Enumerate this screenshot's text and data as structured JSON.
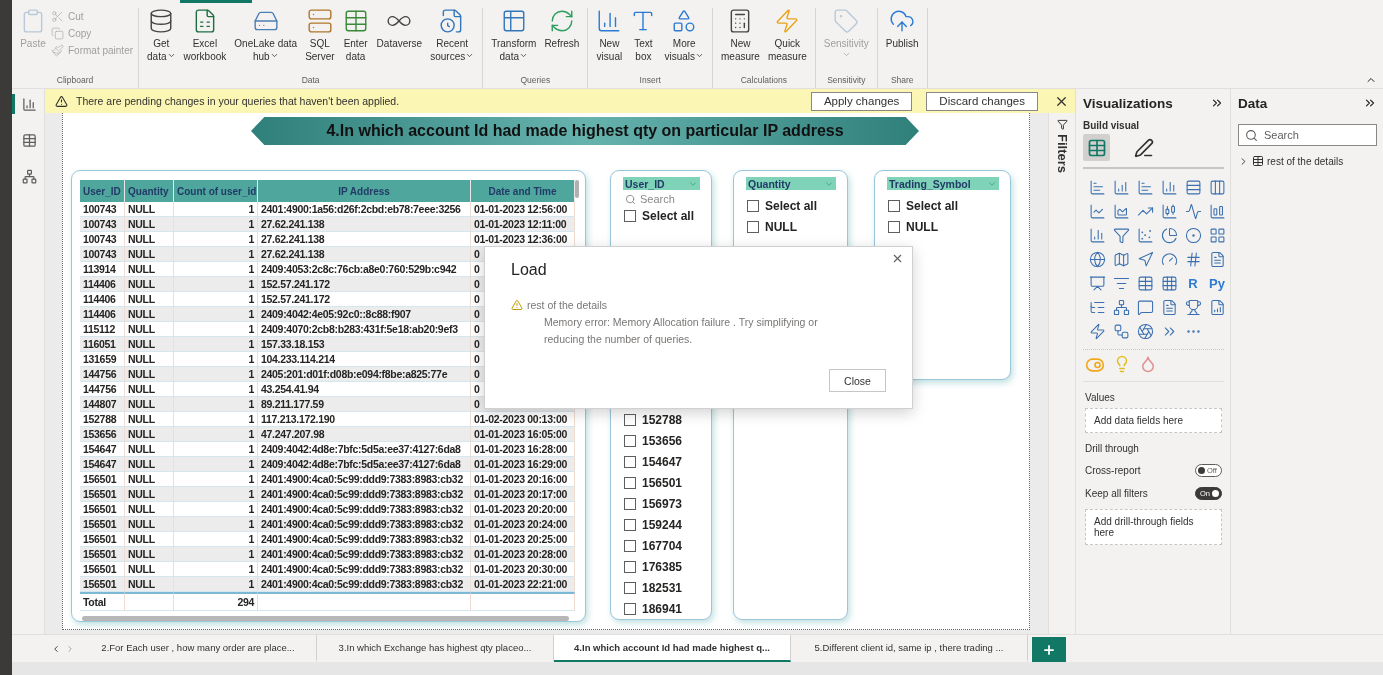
{
  "ribbon": {
    "groups": [
      {
        "label": "Clipboard",
        "buttons": [
          {
            "lines": [
              "Paste"
            ],
            "dropdown": false,
            "disabled": true
          }
        ],
        "small_buttons": [
          {
            "label": "Cut",
            "disabled": true
          },
          {
            "label": "Copy",
            "disabled": true
          },
          {
            "label": "Format painter",
            "disabled": true
          }
        ]
      },
      {
        "label": "Data",
        "buttons": [
          {
            "lines": [
              "Get",
              "data"
            ],
            "dropdown": true,
            "disabled": false
          },
          {
            "lines": [
              "Excel",
              "workbook"
            ],
            "dropdown": false,
            "disabled": false
          },
          {
            "lines": [
              "OneLake data",
              "hub"
            ],
            "dropdown": true,
            "disabled": false
          },
          {
            "lines": [
              "SQL",
              "Server"
            ],
            "dropdown": false,
            "disabled": false
          },
          {
            "lines": [
              "Enter",
              "data"
            ],
            "dropdown": false,
            "disabled": false
          },
          {
            "lines": [
              "Dataverse"
            ],
            "dropdown": false,
            "disabled": false
          },
          {
            "lines": [
              "Recent",
              "sources"
            ],
            "dropdown": true,
            "disabled": false
          }
        ]
      },
      {
        "label": "Queries",
        "buttons": [
          {
            "lines": [
              "Transform",
              "data"
            ],
            "dropdown": true,
            "disabled": false
          },
          {
            "lines": [
              "Refresh"
            ],
            "dropdown": false,
            "disabled": false
          }
        ]
      },
      {
        "label": "Insert",
        "buttons": [
          {
            "lines": [
              "New",
              "visual"
            ],
            "dropdown": false,
            "disabled": false
          },
          {
            "lines": [
              "Text",
              "box"
            ],
            "dropdown": false,
            "disabled": false
          },
          {
            "lines": [
              "More",
              "visuals"
            ],
            "dropdown": true,
            "disabled": false
          }
        ]
      },
      {
        "label": "Calculations",
        "buttons": [
          {
            "lines": [
              "New",
              "measure"
            ],
            "dropdown": false,
            "disabled": false
          },
          {
            "lines": [
              "Quick",
              "measure"
            ],
            "dropdown": false,
            "disabled": false
          }
        ]
      },
      {
        "label": "Sensitivity",
        "buttons": [
          {
            "lines": [
              "Sensitivity"
            ],
            "dropdown": true,
            "disabled": true
          }
        ]
      },
      {
        "label": "Share",
        "buttons": [
          {
            "lines": [
              "Publish"
            ],
            "dropdown": false,
            "disabled": false
          }
        ]
      }
    ]
  },
  "views": [
    {
      "selected": true
    },
    {
      "selected": false
    },
    {
      "selected": false
    }
  ],
  "notification": {
    "message": "There are pending changes in your queries that haven't been applied.",
    "buttons": [
      "Apply changes",
      "Discard changes"
    ]
  },
  "page_title": "4.In which account Id had made highest qty on particular IP address",
  "table": {
    "columns": [
      "User_ID",
      "Quantity",
      "Count of user_id",
      "IP Address",
      "Date and Time"
    ],
    "rows": [
      [
        "100743",
        "NULL",
        "1",
        "2401:4900:1a56:d26f:2cbd:eb78:7eee:3256",
        "01-01-2023 12:56:00"
      ],
      [
        "100743",
        "NULL",
        "1",
        "27.62.241.138",
        "01-01-2023 12:11:00"
      ],
      [
        "100743",
        "NULL",
        "1",
        "27.62.241.138",
        "01-01-2023 12:36:00"
      ],
      [
        "100743",
        "NULL",
        "1",
        "27.62.241.138",
        "0"
      ],
      [
        "113914",
        "NULL",
        "1",
        "2409:4053:2c8c:76cb:a8e0:760:529b:c942",
        "0"
      ],
      [
        "114406",
        "NULL",
        "1",
        "152.57.241.172",
        "0"
      ],
      [
        "114406",
        "NULL",
        "1",
        "152.57.241.172",
        "0"
      ],
      [
        "114406",
        "NULL",
        "1",
        "2409:4042:4e05:92c0::8c88:f907",
        "0"
      ],
      [
        "115112",
        "NULL",
        "1",
        "2409:4070:2cb8:b283:431f:5e18:ab20:9ef3",
        "0"
      ],
      [
        "116051",
        "NULL",
        "1",
        "157.33.18.153",
        "0"
      ],
      [
        "131659",
        "NULL",
        "1",
        "104.233.114.214",
        "0"
      ],
      [
        "144756",
        "NULL",
        "1",
        "2405:201:d01f:d08b:e094:f8be:a825:77e",
        "0"
      ],
      [
        "144756",
        "NULL",
        "1",
        "43.254.41.94",
        "0"
      ],
      [
        "144807",
        "NULL",
        "1",
        "89.211.177.59",
        "0"
      ],
      [
        "152788",
        "NULL",
        "1",
        "117.213.172.190",
        "01-02-2023 00:13:00"
      ],
      [
        "153656",
        "NULL",
        "1",
        "47.247.207.98",
        "01-01-2023 16:05:00"
      ],
      [
        "154647",
        "NULL",
        "1",
        "2409:4042:4d8e:7bfc:5d5a:ee37:4127:6da8",
        "01-01-2023 16:28:00"
      ],
      [
        "154647",
        "NULL",
        "1",
        "2409:4042:4d8e:7bfc:5d5a:ee37:4127:6da8",
        "01-01-2023 16:29:00"
      ],
      [
        "156501",
        "NULL",
        "1",
        "2401:4900:4ca0:5c99:ddd9:7383:8983:cb32",
        "01-01-2023 20:16:00"
      ],
      [
        "156501",
        "NULL",
        "1",
        "2401:4900:4ca0:5c99:ddd9:7383:8983:cb32",
        "01-01-2023 20:17:00"
      ],
      [
        "156501",
        "NULL",
        "1",
        "2401:4900:4ca0:5c99:ddd9:7383:8983:cb32",
        "01-01-2023 20:20:00"
      ],
      [
        "156501",
        "NULL",
        "1",
        "2401:4900:4ca0:5c99:ddd9:7383:8983:cb32",
        "01-01-2023 20:24:00"
      ],
      [
        "156501",
        "NULL",
        "1",
        "2401:4900:4ca0:5c99:ddd9:7383:8983:cb32",
        "01-01-2023 20:25:00"
      ],
      [
        "156501",
        "NULL",
        "1",
        "2401:4900:4ca0:5c99:ddd9:7383:8983:cb32",
        "01-01-2023 20:28:00"
      ],
      [
        "156501",
        "NULL",
        "1",
        "2401:4900:4ca0:5c99:ddd9:7383:8983:cb32",
        "01-01-2023 20:30:00"
      ],
      [
        "156501",
        "NULL",
        "1",
        "2401:4900:4ca0:5c99:ddd9:7383:8983:cb32",
        "01-01-2023 22:21:00"
      ]
    ],
    "total": {
      "label": "Total",
      "count": "294"
    }
  },
  "slicers": [
    {
      "title": "User_ID",
      "search_placeholder": "Search",
      "items": [
        {
          "label": "Select all",
          "checked": false
        }
      ],
      "items_below": [
        {
          "label": "152788",
          "checked": false
        },
        {
          "label": "153656",
          "checked": false
        },
        {
          "label": "154647",
          "checked": false
        },
        {
          "label": "156501",
          "checked": false
        },
        {
          "label": "156973",
          "checked": false
        },
        {
          "label": "159244",
          "checked": false
        },
        {
          "label": "167704",
          "checked": false
        },
        {
          "label": "176385",
          "checked": false
        },
        {
          "label": "182531",
          "checked": false
        },
        {
          "label": "186941",
          "checked": false
        }
      ]
    },
    {
      "title": "Quantity",
      "items": [
        {
          "label": "Select all",
          "checked": false
        },
        {
          "label": "NULL",
          "checked": false
        }
      ]
    },
    {
      "title": "Trading_Symbol",
      "items": [
        {
          "label": "Select all",
          "checked": false
        },
        {
          "label": "NULL",
          "checked": false
        }
      ]
    }
  ],
  "dialog": {
    "title": "Load",
    "source": "rest of the details",
    "message": "Memory error: Memory Allocation failure . Try simplifying or reducing the number of queries.",
    "button": "Close"
  },
  "filters_label": "Filters",
  "visualizations": {
    "title": "Visualizations",
    "build_visual": "Build visual",
    "script_visuals": [
      "R",
      "Py"
    ],
    "values_label": "Values",
    "values_placeholder": "Add data fields here",
    "drill_through": "Drill through",
    "toggles": [
      {
        "label": "Cross-report",
        "on": false,
        "state_label": "Off"
      },
      {
        "label": "Keep all filters",
        "on": true,
        "state_label": "On"
      }
    ],
    "drill_placeholder": "Add drill-through fields here"
  },
  "data_pane": {
    "title": "Data",
    "search_placeholder": "Search",
    "tables": [
      {
        "label": "rest of the details",
        "expanded": false
      }
    ]
  },
  "page_tabs": [
    {
      "label": "2.For Each user , how many order are place...",
      "selected": false
    },
    {
      "label": "3.In which Exchange has highest qty placeo...",
      "selected": false
    },
    {
      "label": "4.In which account Id had made highest q...",
      "selected": true
    },
    {
      "label": "5.Different client id, same ip , there trading ...",
      "selected": false
    }
  ]
}
